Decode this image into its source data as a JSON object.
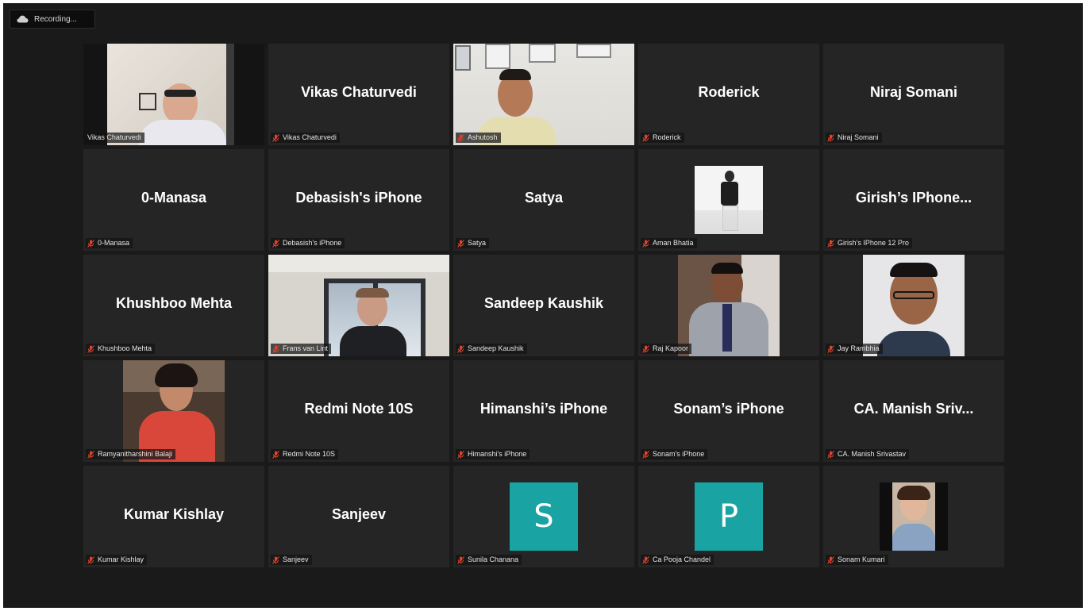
{
  "recording": {
    "label": "Recording..."
  },
  "tiles": [
    {
      "tag": "Vikas Chaturvedi",
      "active": true,
      "media": "video"
    },
    {
      "big": "Vikas Chaturvedi",
      "tag": "Vikas Chaturvedi"
    },
    {
      "tag": "Ashutosh",
      "media": "video"
    },
    {
      "big": "Roderick",
      "tag": "Roderick"
    },
    {
      "big": "Niraj Somani",
      "tag": "Niraj Somani"
    },
    {
      "big": "0-Manasa",
      "tag": "0-Manasa"
    },
    {
      "big": "Debasish's iPhone",
      "tag": "Debasish's iPhone"
    },
    {
      "big": "Satya",
      "tag": "Satya"
    },
    {
      "tag": "Aman Bhatia",
      "media": "photo"
    },
    {
      "big": "Girish’s IPhone...",
      "tag": "Girish’s IPhone 12 Pro"
    },
    {
      "big": "Khushboo Mehta",
      "tag": "Khushboo Mehta"
    },
    {
      "tag": "Frans van Lint",
      "media": "video"
    },
    {
      "big": "Sandeep Kaushik",
      "tag": "Sandeep Kaushik"
    },
    {
      "tag": "Raj Kapoor",
      "media": "photo"
    },
    {
      "tag": "Jay Rambhia",
      "media": "photo"
    },
    {
      "tag": "Ramyanitharshini Balaji",
      "media": "photo"
    },
    {
      "big": "Redmi Note 10S",
      "tag": "Redmi Note 10S"
    },
    {
      "big": "Himanshi’s iPhone",
      "tag": "Himanshi's iPhone"
    },
    {
      "big": "Sonam’s iPhone",
      "tag": "Sonam's iPhone"
    },
    {
      "big": "CA. Manish Sriv...",
      "tag": "CA. Manish Srivastav"
    },
    {
      "big": "Kumar Kishlay",
      "tag": "Kumar Kishlay"
    },
    {
      "big": "Sanjeev",
      "tag": "Sanjeev"
    },
    {
      "tag": "Sunila Chanana",
      "letter": "S"
    },
    {
      "tag": "Ca Pooja Chandel",
      "letter": "P"
    },
    {
      "tag": "Sonam Kumari",
      "media": "photo"
    }
  ],
  "colors": {
    "active_border": "#c5e15e",
    "avatar_bg": "#1aa3a3",
    "muted_mic": "#e0442d",
    "tile_bg": "#252525"
  }
}
